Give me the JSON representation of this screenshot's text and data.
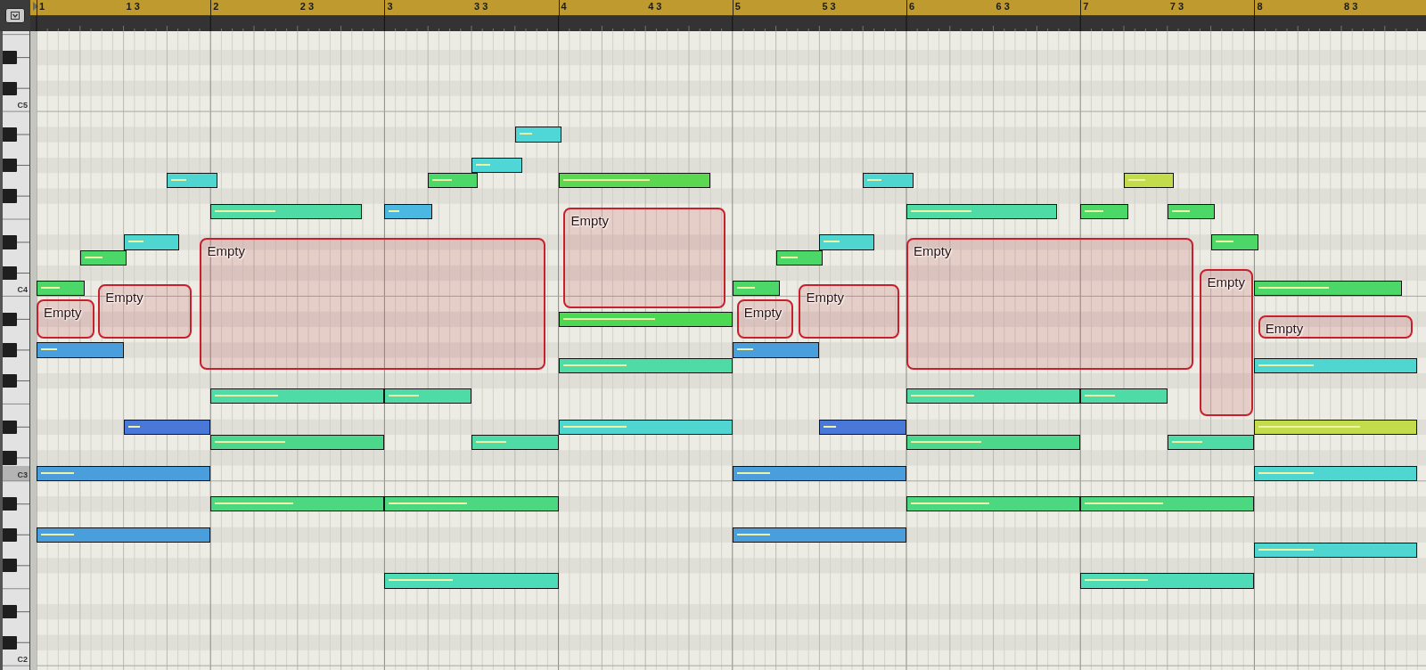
{
  "ruler": {
    "labels": [
      "1",
      "1 3",
      "2",
      "2 3",
      "3",
      "3 3",
      "4",
      "4 3",
      "5",
      "5 3",
      "6",
      "6 3",
      "7",
      "7 3",
      "8",
      "8 3"
    ]
  },
  "keyboard": {
    "c_labels": [
      {
        "label": "C5",
        "highlighted": false
      },
      {
        "label": "C4",
        "highlighted": false
      },
      {
        "label": "C3",
        "highlighted": true
      },
      {
        "label": "C2",
        "highlighted": false
      }
    ]
  },
  "notes": [
    {
      "color": "#4cd868",
      "level": 0.45
    },
    {
      "color": "#4a9edb",
      "level": 0.2
    },
    {
      "color": "#4cd868",
      "level": 0.45
    },
    {
      "color": "#4fd6d0",
      "level": 0.33
    },
    {
      "color": "#4fd6d0",
      "level": 0.33
    },
    {
      "color": "#4a78d8",
      "level": 0.15
    },
    {
      "color": "#4a9edb",
      "level": 0.2
    },
    {
      "color": "#4a9edb",
      "level": 0.2
    },
    {
      "color": "#4edba6",
      "level": 0.42
    },
    {
      "color": "#4edba6",
      "level": 0.38
    },
    {
      "color": "#4cd88a",
      "level": 0.42
    },
    {
      "color": "#4cd880",
      "level": 0.47
    },
    {
      "color": "#4ab8e0",
      "level": 0.25
    },
    {
      "color": "#4cd868",
      "level": 0.45
    },
    {
      "color": "#4fd6d6",
      "level": 0.33
    },
    {
      "color": "#4fd6d6",
      "level": 0.33
    },
    {
      "color": "#4edba6",
      "level": 0.38
    },
    {
      "color": "#4edba6",
      "level": 0.38
    },
    {
      "color": "#4cd880",
      "level": 0.47
    },
    {
      "color": "#4edbb8",
      "level": 0.38
    },
    {
      "color": "#5cd850",
      "level": 0.6
    },
    {
      "color": "#4cd850",
      "level": 0.55
    },
    {
      "color": "#4edba6",
      "level": 0.38
    },
    {
      "color": "#4fd6d0",
      "level": 0.38
    },
    {
      "color": "#4cd868",
      "level": 0.45
    },
    {
      "color": "#4a9edb",
      "level": 0.2
    },
    {
      "color": "#4cd868",
      "level": 0.45
    },
    {
      "color": "#4fd6d0",
      "level": 0.33
    },
    {
      "color": "#4fd6d0",
      "level": 0.33
    },
    {
      "color": "#4a78d8",
      "level": 0.15
    },
    {
      "color": "#4a9edb",
      "level": 0.2
    },
    {
      "color": "#4a9edb",
      "level": 0.2
    },
    {
      "color": "#4edba6",
      "level": 0.42
    },
    {
      "color": "#4edba6",
      "level": 0.38
    },
    {
      "color": "#4cd88a",
      "level": 0.42
    },
    {
      "color": "#4cd880",
      "level": 0.47
    },
    {
      "color": "#4cd868",
      "level": 0.45
    },
    {
      "color": "#c2dc4c",
      "level": 0.4
    },
    {
      "color": "#4cd868",
      "level": 0.45
    },
    {
      "color": "#4cd868",
      "level": 0.45
    },
    {
      "color": "#4edba6",
      "level": 0.38
    },
    {
      "color": "#4edba6",
      "level": 0.38
    },
    {
      "color": "#4cd880",
      "level": 0.47
    },
    {
      "color": "#4edbb8",
      "level": 0.38
    },
    {
      "color": "#4cd868",
      "level": 0.5
    },
    {
      "color": "#4fd6d0",
      "level": 0.35
    },
    {
      "color": "#c2dc4c",
      "level": 0.65
    },
    {
      "color": "#4fd6d0",
      "level": 0.35
    },
    {
      "color": "#4fd6d0",
      "level": 0.35
    }
  ],
  "regions": [
    {
      "label": "Empty"
    },
    {
      "label": "Empty"
    },
    {
      "label": "Empty"
    },
    {
      "label": "Empty"
    },
    {
      "label": "Empty"
    },
    {
      "label": "Empty"
    },
    {
      "label": "Empty"
    },
    {
      "label": "Empty"
    },
    {
      "label": "Empty"
    }
  ]
}
